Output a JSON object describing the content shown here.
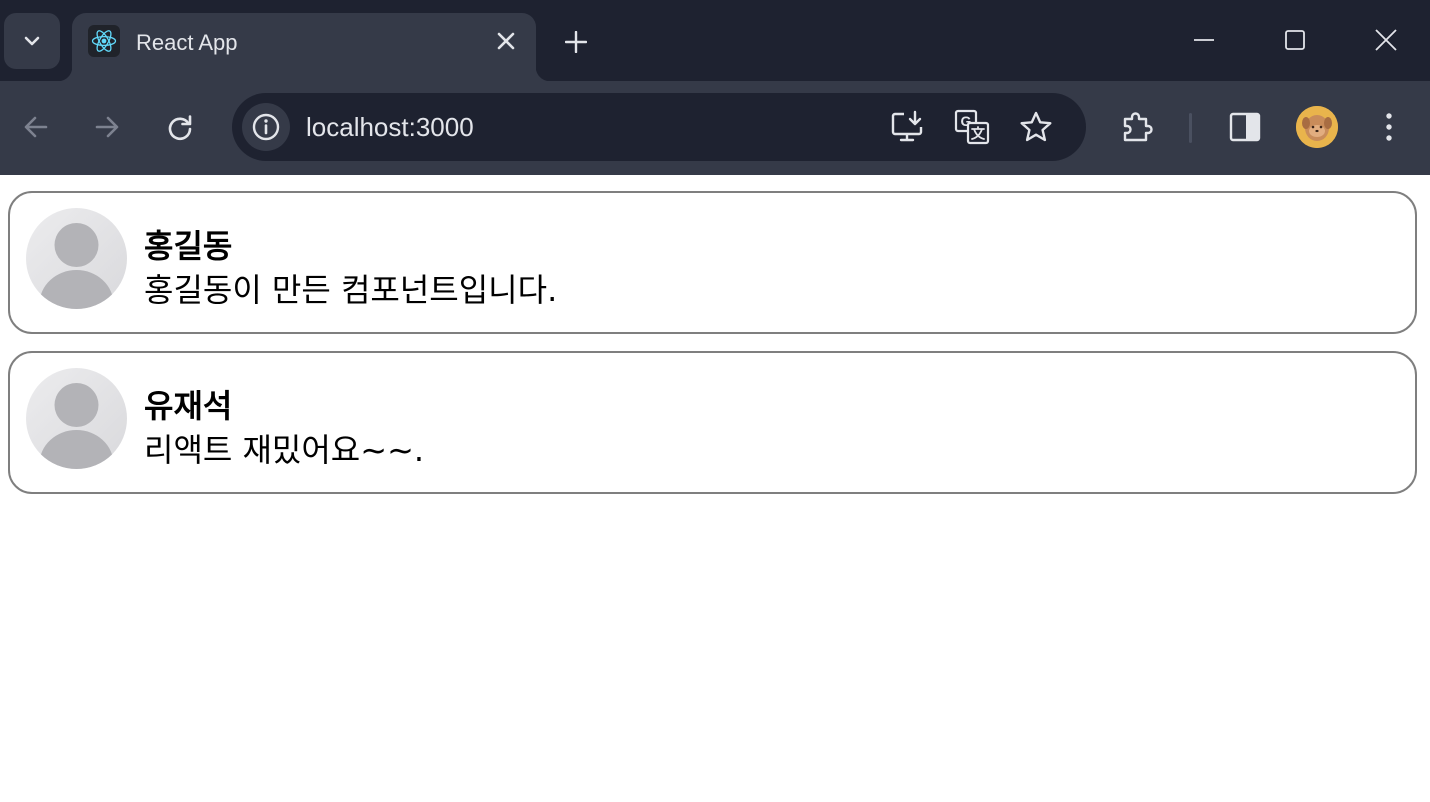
{
  "browser": {
    "tab": {
      "title": "React App",
      "favicon": "react-logo-icon"
    },
    "address_bar": {
      "url": "localhost:3000"
    },
    "colors": {
      "titlebar": "#1e2230",
      "toolbar": "#353a48",
      "omnibox": "#1e2230",
      "text": "#e3e5ea"
    }
  },
  "comments": [
    {
      "name": "홍길동",
      "comment": "홍길동이 만든 컴포넌트입니다.",
      "avatar": "default-user-avatar-icon"
    },
    {
      "name": "유재석",
      "comment": "리액트 재밌어요~~.",
      "avatar": "default-user-avatar-icon"
    }
  ]
}
